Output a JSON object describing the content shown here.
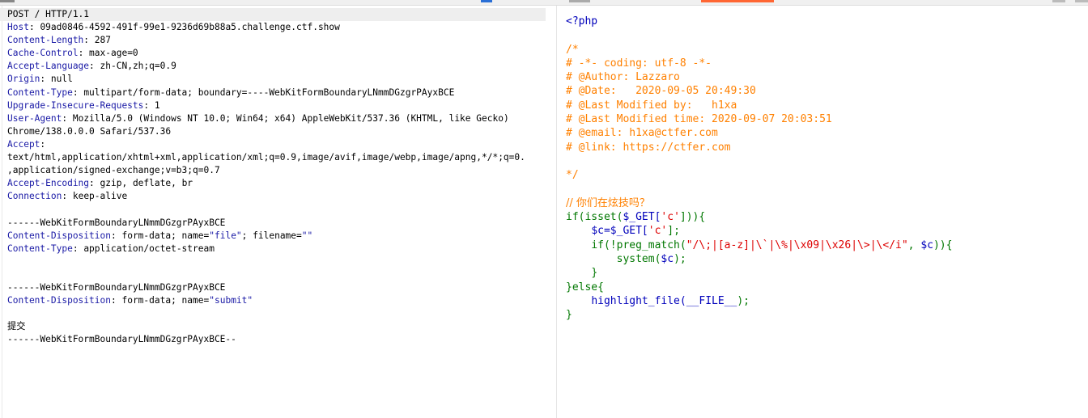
{
  "request": {
    "request_line": "POST / HTTP/1.1",
    "headers": [
      {
        "name": "Host",
        "value": "09ad0846-4592-491f-99e1-9236d69b88a5.challenge.ctf.show"
      },
      {
        "name": "Content-Length",
        "value": "287"
      },
      {
        "name": "Cache-Control",
        "value": "max-age=0"
      },
      {
        "name": "Accept-Language",
        "value": "zh-CN,zh;q=0.9"
      },
      {
        "name": "Origin",
        "value": "null"
      },
      {
        "name": "Content-Type",
        "value": "multipart/form-data; boundary=----WebKitFormBoundaryLNmmDGzgrPAyxBCE"
      },
      {
        "name": "Upgrade-Insecure-Requests",
        "value": "1"
      },
      {
        "name": "User-Agent",
        "value": "Mozilla/5.0 (Windows NT 10.0; Win64; x64) AppleWebKit/537.36 (KHTML, like Gecko)"
      }
    ],
    "ua_continuation": "Chrome/138.0.0.0 Safari/537.36",
    "accept_name": "Accept",
    "accept_value_1": "text/html,application/xhtml+xml,application/xml;q=0.9,image/avif,image/webp,image/apng,*/*;q=0.",
    "accept_value_2": ",application/signed-exchange;v=b3;q=0.7",
    "encoding_name": "Accept-Encoding",
    "encoding_value": "gzip, deflate, br",
    "connection_name": "Connection",
    "connection_value": "keep-alive",
    "boundary": "------WebKitFormBoundaryLNmmDGzgrPAyxBCE",
    "part1_disposition_name": "Content-Disposition",
    "part1_disposition_prefix": "form-data; name=",
    "part1_field": "\"file\"",
    "part1_mid": "; filename=",
    "part1_filename": "\"\"",
    "part1_type_name": "Content-Type",
    "part1_type_value": "application/octet-stream",
    "part2_disposition_name": "Content-Disposition",
    "part2_disposition_prefix": "form-data; name=",
    "part2_field": "\"submit\"",
    "part2_value": "提交",
    "closing_boundary": "------WebKitFormBoundaryLNmmDGzgrPAyxBCE--"
  },
  "response": {
    "open_tag": "<?php",
    "comment_open": "/*",
    "comment_lines": [
      "# -*- coding: utf-8 -*-",
      "# @Author: Lazzaro",
      "# @Date:   2020-09-05 20:49:30",
      "# @Last Modified by:   h1xa",
      "# @Last Modified time: 2020-09-07 20:03:51",
      "# @email: h1xa@ctfer.com",
      "# @link: https://ctfer.com"
    ],
    "comment_close": "*/",
    "cn_comment": "// 你们在炫技吗？",
    "if_kw": "if(isset(",
    "get_var": "$_GET[",
    "c_key": "'c'",
    "if_end": "])){",
    "assign_var": "$c=",
    "assign_get": "$_GET[",
    "assign_key": "'c'",
    "assign_end": "];",
    "pm_kw": "if(!preg_match(",
    "pm_regex": "\"/\\;|[a-z]|\\`|\\%|\\x09|\\x26|\\>|\\</i\"",
    "pm_sep": ", ",
    "pm_var": "$c",
    "pm_end": ")){",
    "sys_kw": "system(",
    "sys_var": "$c",
    "sys_end": ");",
    "brace_inner": "}",
    "else_kw": "}else{",
    "hl_kw": "highlight_file(",
    "hl_const": "__FILE__",
    "hl_end": ");",
    "brace_close": "}"
  }
}
